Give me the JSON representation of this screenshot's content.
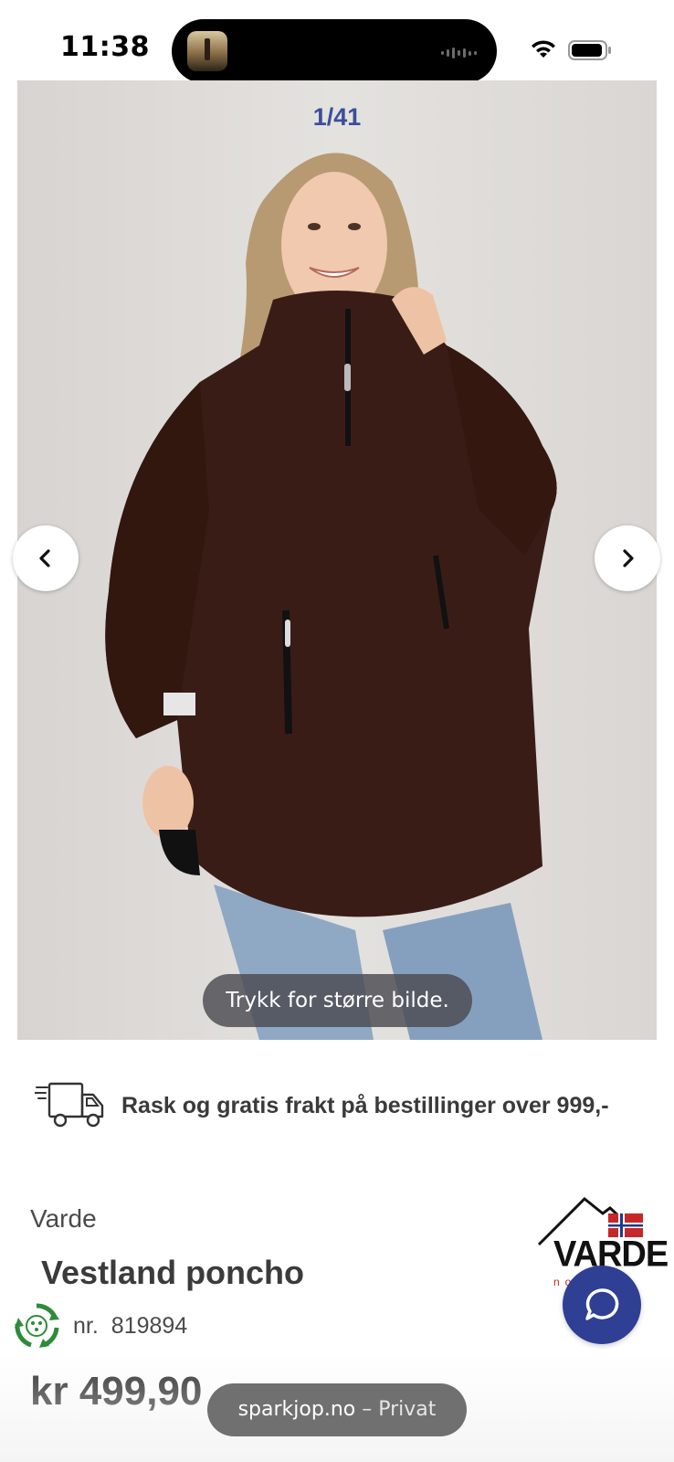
{
  "status_bar": {
    "time": "11:38"
  },
  "gallery": {
    "counter": "1/41",
    "hint": "Trykk for større bilde."
  },
  "shipping": {
    "text": "Rask og gratis frakt på bestillinger over 999,-"
  },
  "product": {
    "brand": "Varde",
    "title": "Vestland poncho",
    "sku_prefix": "nr.",
    "sku": "819894",
    "price": "kr 499,90"
  },
  "brand_logo": {
    "text": "VARDE",
    "sub": "norway"
  },
  "browser": {
    "domain": "sparkjop.no",
    "separator": "–",
    "mode": "Privat"
  },
  "colors": {
    "accent": "#2f3f93",
    "counter": "#3b4f9a",
    "coat": "#3a1c17"
  }
}
